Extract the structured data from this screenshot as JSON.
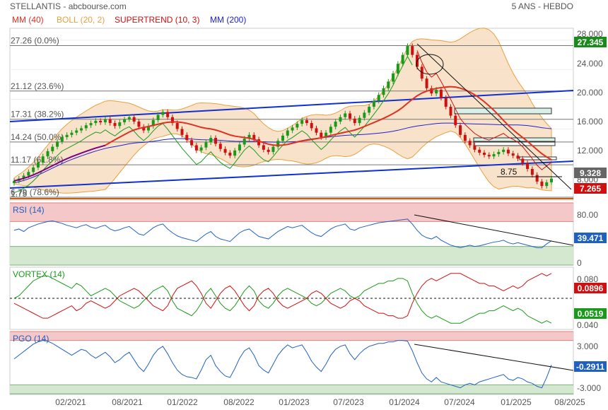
{
  "header": {
    "title": "STELLANTIS - abcbourse.com",
    "period": "5 ANS - HEBDO"
  },
  "colors": {
    "mm40": "#e03020",
    "boll": "#e8a040",
    "boll_fill": "#f5d9b8",
    "supertrend": "#d01010",
    "mm200": "#2020d0",
    "candle_up": "#1a9a1a",
    "candle_down": "#d01010",
    "trend_blue": "#1030d0",
    "fib": "#777777",
    "rsi_line": "#2060c0",
    "vortex_plus": "#1a9a1a",
    "vortex_minus": "#d01010",
    "pgo_line": "#2060c0",
    "zone_red": "#f4c8c8",
    "zone_green": "#d4e8d0"
  },
  "legend": [
    {
      "label": "MM (40)",
      "color": "#e03020"
    },
    {
      "label": "BOLL (20, 2)",
      "color": "#e8a040"
    },
    {
      "label": "SUPERTREND (10, 3)",
      "color": "#d01010"
    },
    {
      "label": "MM (200)",
      "color": "#2020d0"
    }
  ],
  "chart_data": [
    {
      "type": "candlestick",
      "panel": "price",
      "yticks": [
        "28.000",
        "24.000",
        "20.000",
        "16.000",
        "12.000",
        "8.000"
      ],
      "ylim": [
        6.5,
        29.5
      ],
      "fib_levels": [
        {
          "price": 27.26,
          "label": "27.26 (0.0%)"
        },
        {
          "price": 21.12,
          "label": "21.12 (23.6%)"
        },
        {
          "price": 17.31,
          "label": "17.31 (38.2%)"
        },
        {
          "price": 14.24,
          "label": "14.24 (50.0%)"
        },
        {
          "price": 11.17,
          "label": "11.17 (61.8%)"
        },
        {
          "price": 6.79,
          "label": "6.79 (78.6%)"
        },
        {
          "price": 1.75,
          "label": "1.75"
        }
      ],
      "annotation": "8.75",
      "price_tags": [
        {
          "value": "27.345",
          "bg": "#1a8a1a"
        },
        {
          "value": "9.328",
          "bg": "#666666"
        },
        {
          "value": "7.265",
          "bg": "#d01010"
        }
      ],
      "closes": [
        9.0,
        9.3,
        9.7,
        10.2,
        10.8,
        11.5,
        12.3,
        13.0,
        13.6,
        14.3,
        14.9,
        15.2,
        15.5,
        15.8,
        16.1,
        16.5,
        16.8,
        17.1,
        16.9,
        17.3,
        16.8,
        16.4,
        16.9,
        17.3,
        17.6,
        17.0,
        16.3,
        15.8,
        16.4,
        17.2,
        17.9,
        18.3,
        17.6,
        16.8,
        16.0,
        15.2,
        14.5,
        13.8,
        13.1,
        13.5,
        14.2,
        14.8,
        14.0,
        13.3,
        12.8,
        12.4,
        13.1,
        13.9,
        14.7,
        15.2,
        14.6,
        13.8,
        13.2,
        12.9,
        13.6,
        14.4,
        15.1,
        15.8,
        16.2,
        16.7,
        17.2,
        16.8,
        16.1,
        15.5,
        14.9,
        15.5,
        16.3,
        17.0,
        17.6,
        18.1,
        17.4,
        16.8,
        17.5,
        18.2,
        19.0,
        19.8,
        20.6,
        21.5,
        22.4,
        23.5,
        24.8,
        26.0,
        27.2,
        26.0,
        24.4,
        22.8,
        21.5,
        20.8,
        21.3,
        20.2,
        19.0,
        17.8,
        16.5,
        15.2,
        14.4,
        13.8,
        13.2,
        12.8,
        12.5,
        12.3,
        12.6,
        12.9,
        13.2,
        12.7,
        12.4,
        12.0,
        11.4,
        10.6,
        9.8,
        8.9,
        8.3,
        8.8,
        9.3
      ]
    },
    {
      "type": "line",
      "panel": "RSI (14)",
      "title": "RSI (14)",
      "yticks": [
        "80.00",
        "0"
      ],
      "value_tag": "39.471",
      "values": [
        56,
        58,
        54,
        60,
        63,
        66,
        68,
        70,
        71,
        69,
        67,
        64,
        62,
        60,
        63,
        65,
        61,
        59,
        62,
        64,
        58,
        55,
        57,
        60,
        62,
        56,
        50,
        48,
        54,
        60,
        64,
        66,
        58,
        52,
        47,
        44,
        42,
        40,
        38,
        44,
        50,
        54,
        46,
        42,
        40,
        38,
        45,
        52,
        56,
        58,
        52,
        46,
        44,
        42,
        48,
        54,
        58,
        62,
        60,
        62,
        64,
        58,
        52,
        48,
        46,
        52,
        58,
        62,
        64,
        66,
        58,
        56,
        60,
        62,
        64,
        66,
        68,
        69,
        70,
        71,
        72,
        73,
        74,
        66,
        56,
        48,
        44,
        42,
        46,
        40,
        36,
        32,
        30,
        28,
        30,
        32,
        30,
        31,
        33,
        35,
        37,
        38,
        40,
        36,
        34,
        36,
        34,
        32,
        30,
        28,
        28,
        34,
        39
      ]
    },
    {
      "type": "line",
      "panel": "VORTEX (14)",
      "title": "VORTEX (14)",
      "yticks": [
        "0.080",
        "0.040"
      ],
      "value_tags": [
        {
          "value": "0.0896",
          "bg": "#d01010"
        },
        {
          "value": "0.0519",
          "bg": "#1a9a1a"
        }
      ],
      "series": [
        {
          "name": "VI+",
          "values": [
            1.0,
            1.02,
            1.06,
            1.1,
            1.14,
            1.16,
            1.18,
            1.18,
            1.16,
            1.14,
            1.12,
            1.1,
            1.08,
            1.12,
            1.1,
            1.06,
            1.02,
            1.04,
            1.06,
            1.08,
            1.06,
            1.02,
            0.98,
            0.96,
            0.94,
            0.92,
            0.94,
            0.98,
            1.02,
            1.06,
            1.08,
            1.1,
            1.06,
            0.98,
            0.92,
            0.9,
            0.88,
            0.86,
            0.9,
            0.96,
            1.04,
            1.08,
            1.02,
            0.96,
            0.92,
            0.9,
            0.94,
            1.0,
            1.06,
            1.1,
            1.06,
            0.98,
            0.94,
            0.92,
            0.96,
            1.02,
            1.06,
            1.08,
            1.06,
            1.04,
            1.02,
            1.0,
            0.96,
            0.94,
            0.96,
            1.0,
            1.04,
            1.06,
            1.08,
            1.06,
            1.02,
            1.0,
            1.02,
            1.06,
            1.08,
            1.1,
            1.12,
            1.12,
            1.14,
            1.14,
            1.16,
            1.16,
            1.14,
            1.04,
            0.96,
            0.9,
            0.86,
            0.84,
            0.86,
            0.84,
            0.82,
            0.8,
            0.8,
            0.8,
            0.82,
            0.84,
            0.86,
            0.88,
            0.88,
            0.9,
            0.9,
            0.92,
            0.94,
            0.92,
            0.9,
            0.92,
            0.9,
            0.86,
            0.84,
            0.82,
            0.8,
            0.82,
            0.8
          ]
        },
        {
          "name": "VI-",
          "values": [
            0.96,
            0.94,
            0.92,
            0.9,
            0.88,
            0.86,
            0.84,
            0.84,
            0.86,
            0.88,
            0.9,
            0.92,
            0.94,
            0.9,
            0.92,
            0.96,
            0.98,
            0.96,
            0.94,
            0.92,
            0.94,
            0.98,
            1.02,
            1.04,
            1.06,
            1.08,
            1.06,
            1.02,
            0.98,
            0.94,
            0.92,
            0.9,
            0.94,
            1.02,
            1.08,
            1.1,
            1.12,
            1.14,
            1.1,
            1.04,
            0.96,
            0.92,
            0.98,
            1.04,
            1.08,
            1.1,
            1.06,
            1.0,
            0.94,
            0.9,
            0.94,
            1.02,
            1.06,
            1.08,
            1.04,
            0.98,
            0.94,
            0.92,
            0.94,
            0.96,
            0.98,
            1.0,
            1.04,
            1.06,
            1.04,
            1.0,
            0.96,
            0.94,
            0.92,
            0.94,
            0.98,
            1.0,
            0.98,
            0.94,
            0.92,
            0.9,
            0.88,
            0.88,
            0.86,
            0.86,
            0.84,
            0.84,
            0.86,
            0.96,
            1.04,
            1.1,
            1.14,
            1.16,
            1.14,
            1.16,
            1.18,
            1.2,
            1.2,
            1.2,
            1.18,
            1.16,
            1.14,
            1.12,
            1.12,
            1.1,
            1.1,
            1.08,
            1.06,
            1.08,
            1.1,
            1.08,
            1.1,
            1.14,
            1.16,
            1.18,
            1.2,
            1.18,
            1.2
          ]
        }
      ]
    },
    {
      "type": "line",
      "panel": "PGO (14)",
      "title": "PGO (14)",
      "yticks": [
        "3.000",
        "-3.000"
      ],
      "value_tag": "-0.2911",
      "values": [
        0.5,
        1.0,
        1.5,
        2.0,
        2.5,
        2.8,
        3.0,
        2.9,
        2.6,
        2.2,
        1.8,
        1.4,
        1.0,
        1.4,
        1.8,
        1.6,
        1.0,
        0.6,
        1.0,
        1.4,
        0.8,
        0.0,
        0.4,
        1.0,
        1.4,
        0.4,
        -0.6,
        -1.2,
        -0.2,
        1.0,
        1.8,
        2.2,
        1.2,
        0.0,
        -1.0,
        -1.6,
        -1.9,
        -2.0,
        -2.2,
        -1.0,
        0.4,
        1.0,
        -0.4,
        -1.2,
        -1.8,
        -2.0,
        -0.8,
        0.6,
        1.6,
        2.0,
        1.0,
        -0.4,
        -1.0,
        -1.4,
        -0.2,
        1.0,
        1.8,
        2.4,
        2.0,
        2.2,
        2.4,
        1.4,
        0.2,
        -0.6,
        -1.2,
        -0.2,
        1.0,
        1.8,
        2.2,
        2.4,
        1.2,
        0.4,
        1.2,
        1.8,
        2.2,
        2.4,
        2.6,
        2.6,
        2.8,
        2.8,
        3.0,
        3.0,
        2.9,
        1.6,
        0.0,
        -1.4,
        -2.2,
        -2.6,
        -2.0,
        -2.6,
        -2.8,
        -3.0,
        -3.2,
        -3.4,
        -3.0,
        -2.8,
        -3.0,
        -2.6,
        -2.4,
        -2.2,
        -2.0,
        -1.8,
        -1.6,
        -2.2,
        -2.4,
        -2.0,
        -2.2,
        -2.6,
        -2.8,
        -3.2,
        -3.4,
        -2.0,
        -0.3
      ]
    }
  ],
  "xaxis": {
    "ticks": [
      "02/2021",
      "08/2021",
      "01/2022",
      "08/2022",
      "01/2023",
      "07/2023",
      "01/2024",
      "07/2024",
      "01/2025",
      "08/2025"
    ]
  }
}
